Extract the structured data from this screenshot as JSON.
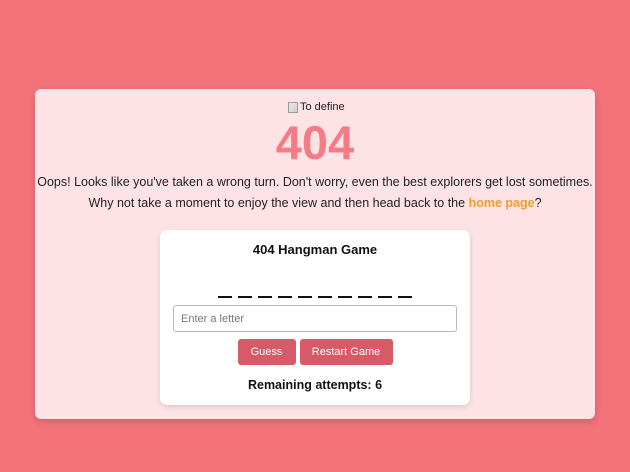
{
  "page": {
    "background_color": "#f3737a",
    "card_color": "#fde3e5"
  },
  "hero": {
    "image_alt": "To define",
    "code": "404",
    "message_line1": "Oops! Looks like you've taken a wrong turn. Don't worry, even the best explorers get lost sometimes.",
    "message_line2_before": "Why not take a moment to enjoy the view and then head back to the ",
    "home_link_text": "home page",
    "message_line2_after": "?"
  },
  "game": {
    "title": "404 Hangman Game",
    "word_slots": [
      "_",
      "_",
      "_",
      "_",
      "_",
      "_",
      "_",
      "_",
      "_",
      "_"
    ],
    "input_placeholder": "Enter a letter",
    "input_value": "",
    "guess_label": "Guess",
    "restart_label": "Restart Game",
    "attempts_label": "Remaining attempts: 6",
    "button_color": "#d65a68"
  },
  "colors": {
    "accent_link": "#f39c2a",
    "code_color": "#f57c86"
  }
}
